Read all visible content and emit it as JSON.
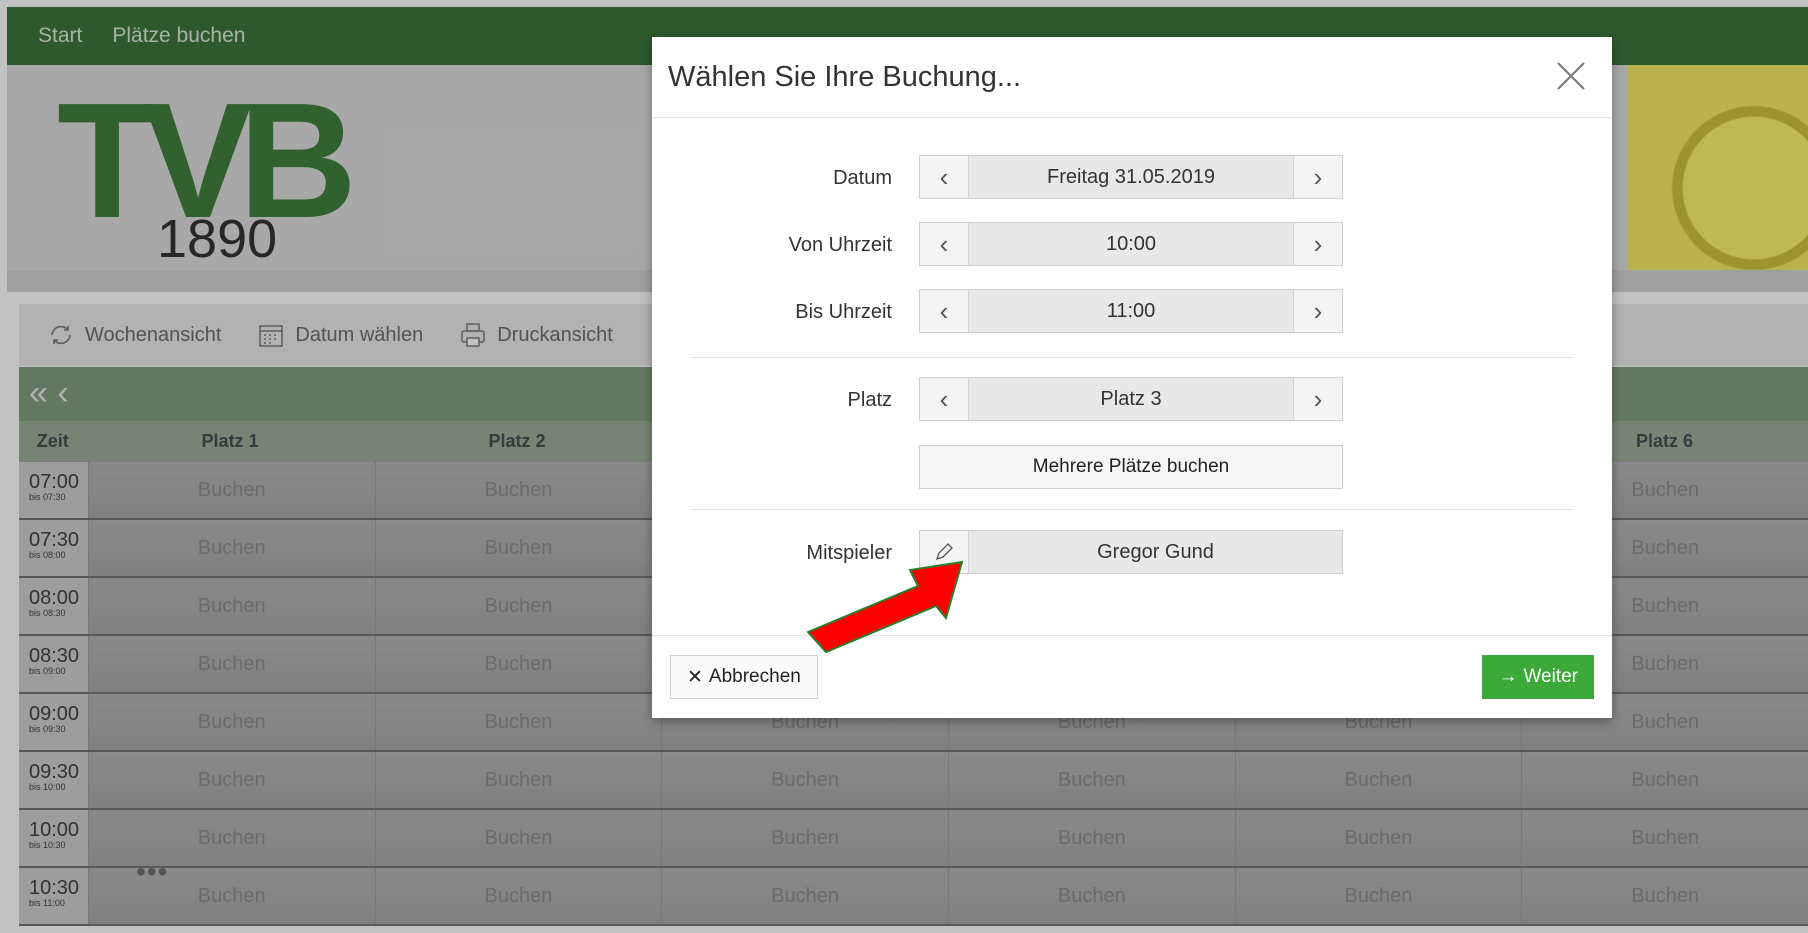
{
  "nav": {
    "items": [
      "Start",
      "Plätze buchen"
    ]
  },
  "logo": {
    "text": "TVB",
    "year": "1890"
  },
  "toolbar": {
    "week_view": "Wochenansicht",
    "choose_date": "Datum wählen",
    "print_view": "Druckansicht"
  },
  "grid": {
    "nav_arrows": "« ‹",
    "headers": [
      "Zeit",
      "Platz 1",
      "Platz 2",
      "",
      "",
      "",
      "Platz 6"
    ],
    "cell_label": "Buchen",
    "rows": [
      {
        "time": "07:00",
        "until": "bis 07:30"
      },
      {
        "time": "07:30",
        "until": "bis 08:00"
      },
      {
        "time": "08:00",
        "until": "bis 08:30"
      },
      {
        "time": "08:30",
        "until": "bis 09:00"
      },
      {
        "time": "09:00",
        "until": "bis 09:30"
      },
      {
        "time": "09:30",
        "until": "bis 10:00"
      },
      {
        "time": "10:00",
        "until": "bis 10:30"
      },
      {
        "time": "10:30",
        "until": "bis 11:00"
      }
    ]
  },
  "modal": {
    "title": "Wählen Sie Ihre Buchung...",
    "date_label": "Datum",
    "date_value": "Freitag 31.05.2019",
    "from_label": "Von Uhrzeit",
    "from_value": "10:00",
    "to_label": "Bis Uhrzeit",
    "to_value": "11:00",
    "court_label": "Platz",
    "court_value": "Platz 3",
    "multi_button": "Mehrere Plätze buchen",
    "partner_label": "Mitspieler",
    "partner_value": "Gregor Gund",
    "cancel_button": "Abbrechen",
    "next_button": "Weiter"
  },
  "colors": {
    "nav_green": "#1b5e1a",
    "next_green": "#3da93b",
    "annotation_red": "#ff0000"
  }
}
